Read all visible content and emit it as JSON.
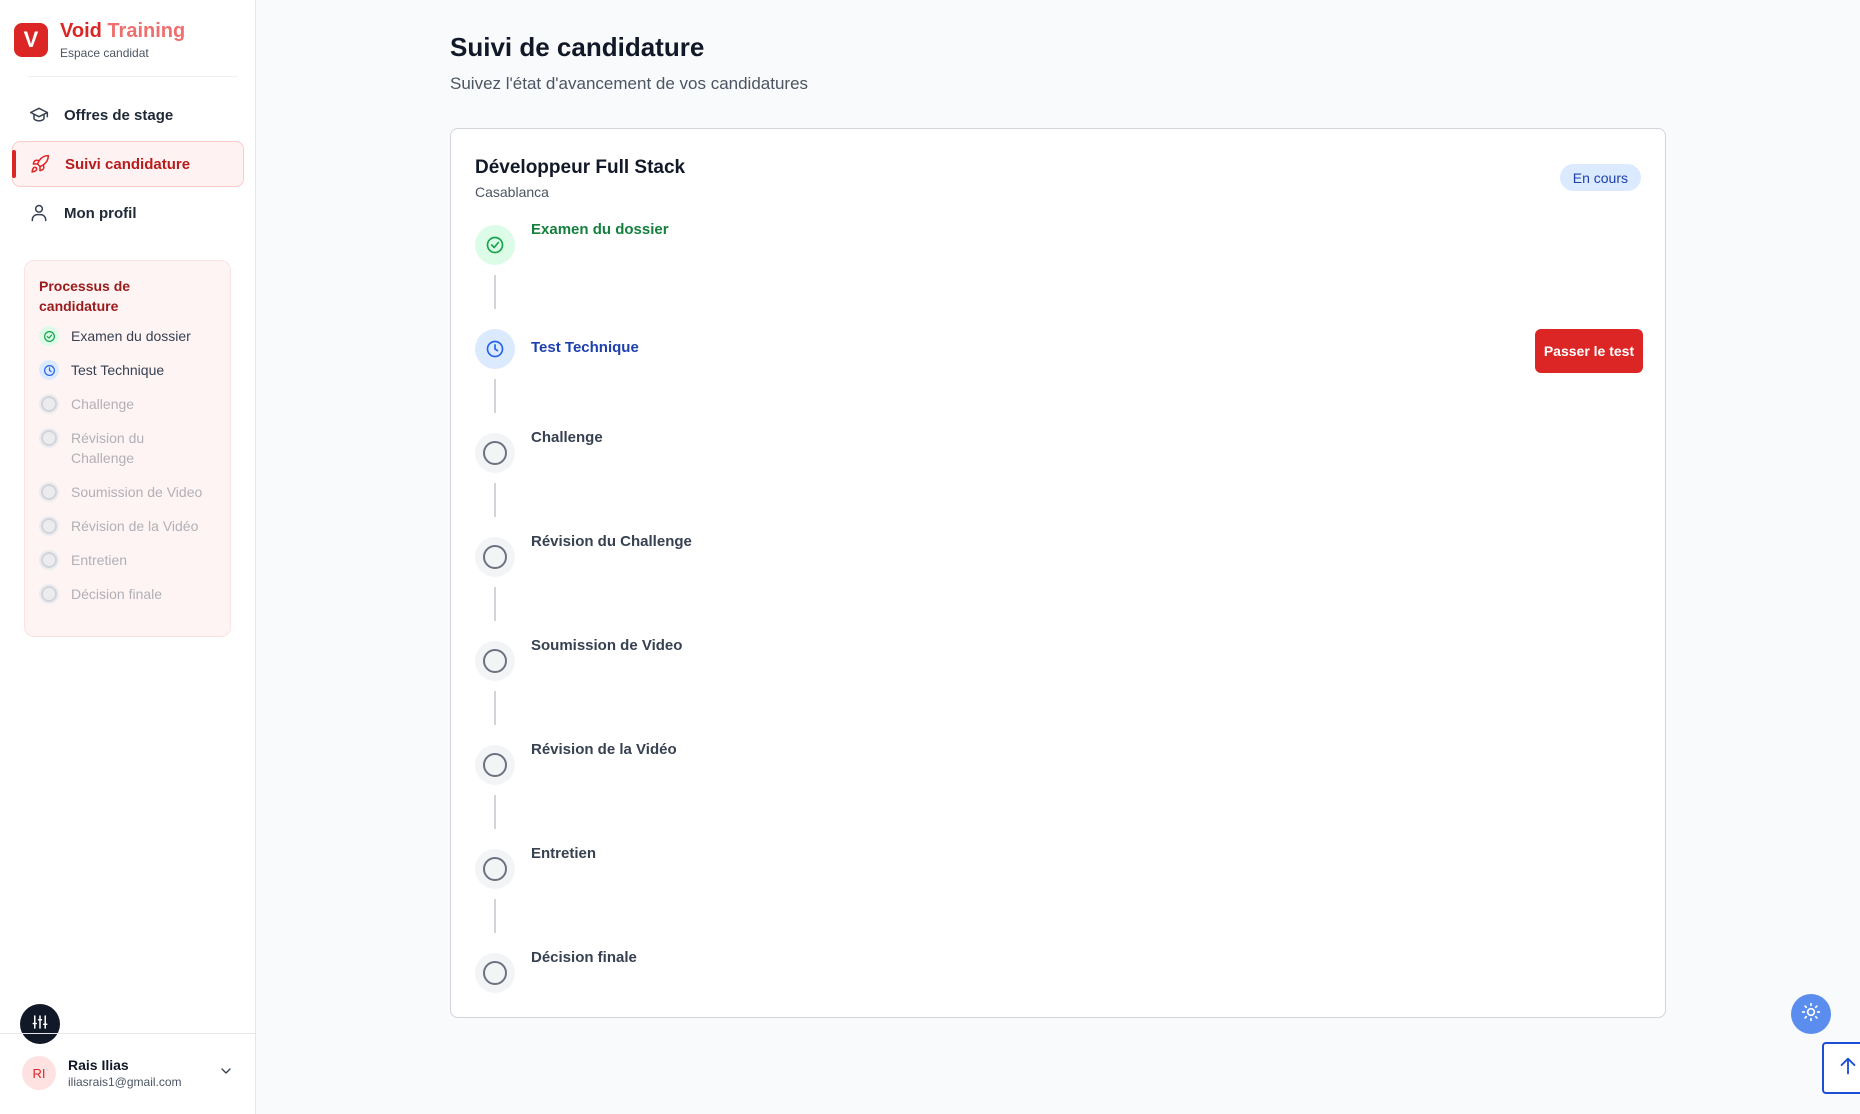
{
  "brand": {
    "logo_letter": "V",
    "name_part1": "Void",
    "name_part2": "Training",
    "subtitle": "Espace candidat",
    "color": "#dc2626"
  },
  "nav": {
    "items": [
      {
        "label": "Offres de stage",
        "icon": "graduation-cap-icon",
        "active": false
      },
      {
        "label": "Suivi candidature",
        "icon": "rocket-icon",
        "active": true
      },
      {
        "label": "Mon profil",
        "icon": "user-icon",
        "active": false
      }
    ]
  },
  "process": {
    "title": "Processus de candidature",
    "steps": [
      {
        "label": "Examen du dossier",
        "status": "done"
      },
      {
        "label": "Test Technique",
        "status": "current"
      },
      {
        "label": "Challenge",
        "status": "pending"
      },
      {
        "label": "Révision du Challenge",
        "status": "pending"
      },
      {
        "label": "Soumission de Video",
        "status": "pending"
      },
      {
        "label": "Révision de la Vidéo",
        "status": "pending"
      },
      {
        "label": "Entretien",
        "status": "pending"
      },
      {
        "label": "Décision finale",
        "status": "pending"
      }
    ]
  },
  "user": {
    "initials": "RI",
    "name": "Rais Ilias",
    "email": "iliasrais1@gmail.com"
  },
  "main": {
    "title": "Suivi de candidature",
    "subtitle": "Suivez l'état d'avancement de vos candidatures"
  },
  "application": {
    "job_title": "Développeur Full Stack",
    "location": "Casablanca",
    "status_badge": "En cours",
    "action_label": "Passer le test",
    "steps": [
      {
        "label": "Examen du dossier",
        "status": "done"
      },
      {
        "label": "Test Technique",
        "status": "current"
      },
      {
        "label": "Challenge",
        "status": "pending"
      },
      {
        "label": "Révision du Challenge",
        "status": "pending"
      },
      {
        "label": "Soumission de Video",
        "status": "pending"
      },
      {
        "label": "Révision de la Vidéo",
        "status": "pending"
      },
      {
        "label": "Entretien",
        "status": "pending"
      },
      {
        "label": "Décision finale",
        "status": "pending"
      }
    ]
  },
  "colors": {
    "accent": "#dc2626",
    "done": "#15803d",
    "current": "#1e40af"
  }
}
